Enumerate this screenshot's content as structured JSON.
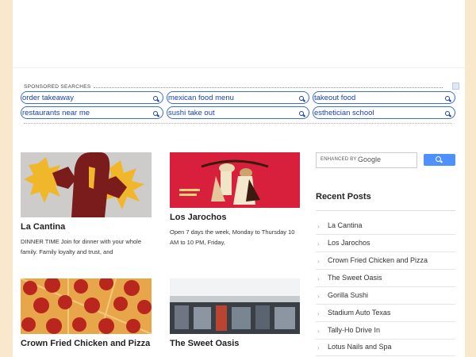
{
  "sponsored": {
    "title": "SPONSORED SEARCHES",
    "items": [
      "order takeaway",
      "mexican food menu",
      "takeout food",
      "restaurants near me",
      "sushi take out",
      "esthetician school"
    ]
  },
  "posts": [
    {
      "title": "La Cantina",
      "excerpt": "DINNER TIME Join for dinner with your whole family. Family loyalty and trust, and"
    },
    {
      "title": "Los Jarochos",
      "excerpt": "Open 7 days the week, Monday to Thursday 10 AM to 10 PM, Friday,"
    },
    {
      "title": "Crown Fried Chicken and Pizza",
      "excerpt": ""
    },
    {
      "title": "The Sweet Oasis",
      "excerpt": ""
    }
  ],
  "search": {
    "enhanced_by": "ENHANCED BY",
    "google": "Google"
  },
  "sidebar": {
    "recent_title": "Recent Posts",
    "recent": [
      "La Cantina",
      "Los Jarochos",
      "Crown Fried Chicken and Pizza",
      "The Sweet Oasis",
      "Gorilla Sushi",
      "Stadium Auto Texas",
      "Tally-Ho Drive In",
      "Lotus Nails and Spa"
    ]
  },
  "colors": {
    "page_bg": "#f9e8cb",
    "ad_link": "#1a3fb3",
    "search_button": "#4d90fe"
  }
}
